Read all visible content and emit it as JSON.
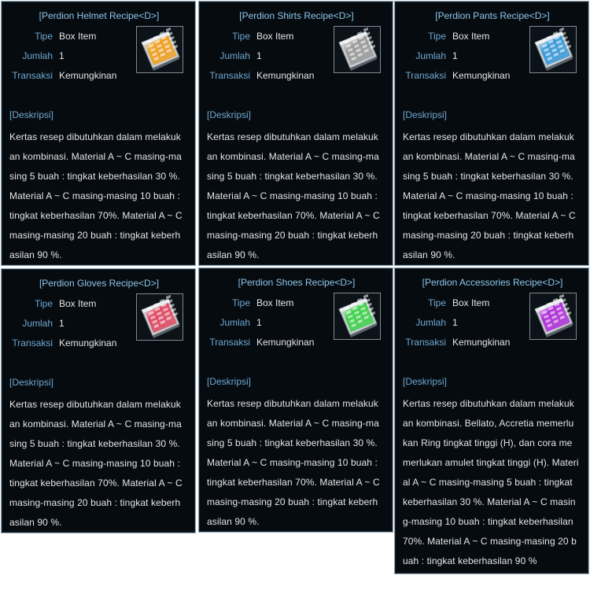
{
  "labels": {
    "tipe": "Tipe",
    "jumlah": "Jumlah",
    "transaksi": "Transaksi",
    "deskripsi": "[Deskripsi]"
  },
  "cards": [
    {
      "title": "[Perdion Helmet Recipe<D>]",
      "tipe": "Box Item",
      "jumlah": "1",
      "transaksi": "Kemungkinan",
      "icon": "recipe-book-icon",
      "color": "#f0a020",
      "desc": [
        "Kertas resep dibutuhkan dalam melakuk",
        "an kombinasi. Material A ~ C masing-ma",
        "sing 5 buah : tingkat keberhasilan 30 %.",
        "Material A ~ C  masing-masing 10 buah :",
        "tingkat keberhasilan 70%. Material A ~ C",
        "masing-masing 20 buah : tingkat keberh",
        "asilan 90 %."
      ]
    },
    {
      "title": "[Perdion Shirts Recipe<D>]",
      "tipe": "Box Item",
      "jumlah": "1",
      "transaksi": "Kemungkinan",
      "icon": "recipe-book-icon",
      "color": "#9a9a9a",
      "desc": [
        "Kertas resep dibutuhkan dalam melakuk",
        "an kombinasi. Material A ~ C masing-ma",
        "sing 5 buah : tingkat keberhasilan 30 %.",
        "Material A ~ C  masing-masing 10 buah :",
        "tingkat keberhasilan 70%. Material A ~ C",
        "masing-masing 20 buah : tingkat keberh",
        "asilan 90 %."
      ]
    },
    {
      "title": "[Perdion Pants Recipe<D>]",
      "tipe": "Box Item",
      "jumlah": "1",
      "transaksi": "Kemungkinan",
      "icon": "recipe-book-icon",
      "color": "#3a9ad8",
      "desc": [
        "Kertas resep dibutuhkan dalam melakuk",
        "an kombinasi. Material A ~ C masing-ma",
        "sing 5 buah : tingkat keberhasilan 30 %.",
        "Material A ~ C  masing-masing 10 buah :",
        "tingkat keberhasilan 70%. Material A ~ C",
        "masing-masing 20 buah : tingkat keberh",
        "asilan 90 %."
      ]
    },
    {
      "title": "[Perdion Gloves Recipe<D>]",
      "tipe": "Box Item",
      "jumlah": "1",
      "transaksi": "Kemungkinan",
      "icon": "recipe-book-icon",
      "color": "#e04a62",
      "desc": [
        "Kertas resep dibutuhkan dalam melakuk",
        "an kombinasi. Material A ~ C masing-ma",
        "sing 5 buah : tingkat keberhasilan 30 %.",
        "Material A ~ C  masing-masing 10 buah :",
        "tingkat keberhasilan 70%. Material A ~ C",
        "masing-masing 20 buah : tingkat keberh",
        "asilan 90 %."
      ]
    },
    {
      "title": "[Perdion Shoes Recipe<D>]",
      "tipe": "Box Item",
      "jumlah": "1",
      "transaksi": "Kemungkinan",
      "icon": "recipe-book-icon",
      "color": "#3ed04a",
      "desc": [
        "Kertas resep dibutuhkan dalam melakuk",
        "an kombinasi. Material A ~ C masing-ma",
        "sing 5 buah : tingkat keberhasilan 30 %.",
        "Material A ~ C  masing-masing 10 buah :",
        "tingkat keberhasilan 70%. Material A ~ C",
        "masing-masing 20 buah : tingkat keberh",
        "asilan 90 %."
      ]
    },
    {
      "title": "[Perdion Accessories Recipe<D>]",
      "tipe": "Box Item",
      "jumlah": "1",
      "transaksi": "Kemungkinan",
      "icon": "recipe-book-icon",
      "color": "#b030d8",
      "desc": [
        "Kertas resep dibutuhkan dalam melakuk",
        "an kombinasi. Bellato, Accretia memerlu",
        "kan Ring tingkat tinggi (H), dan cora me",
        "merlukan amulet tingkat tinggi (H). Materi",
        "al A ~ C masing-masing 5 buah : tingkat",
        "keberhasilan 30 %. Material A ~ C  masin",
        "g-masing 10 buah : tingkat keberhasilan",
        "70%. Material A ~ C masing-masing 20 b",
        "uah : tingkat keberhasilan 90 %"
      ]
    }
  ]
}
